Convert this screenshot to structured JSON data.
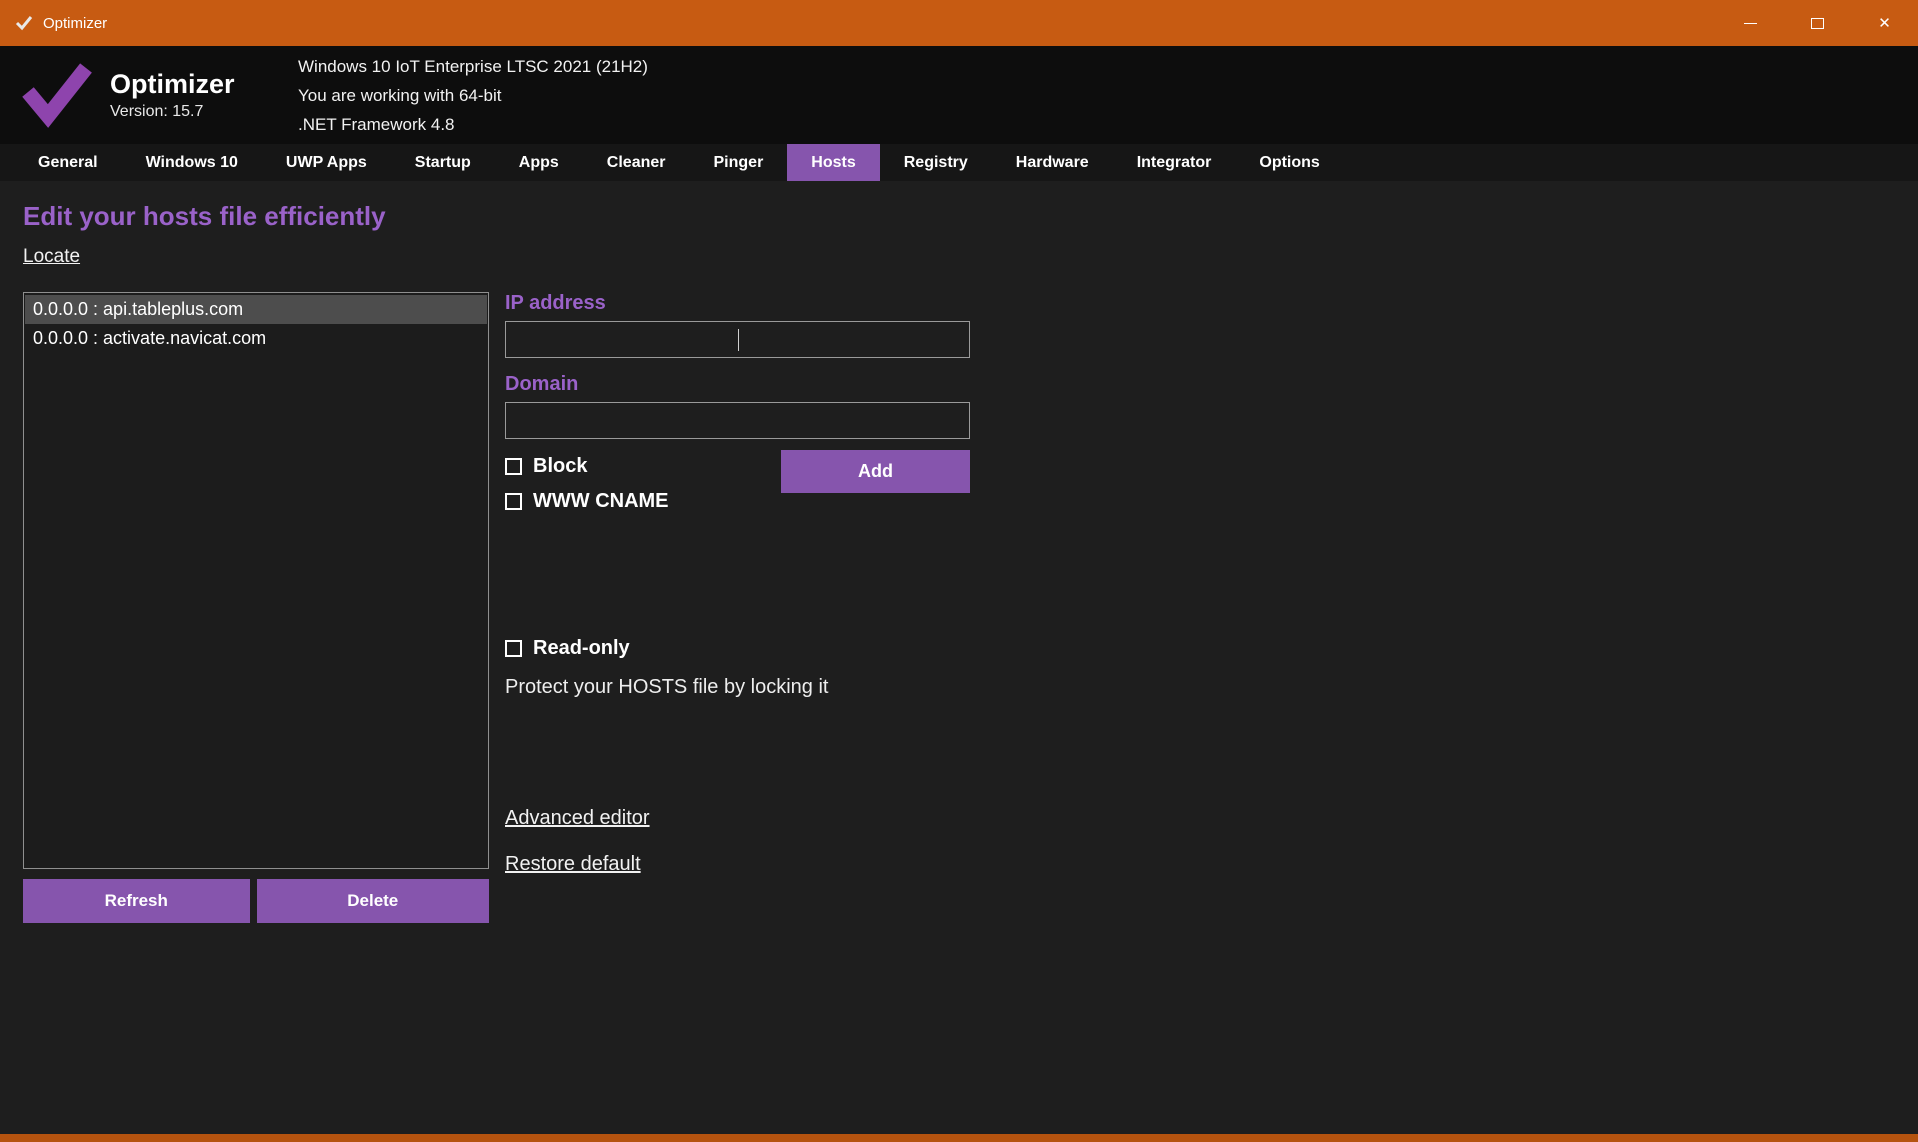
{
  "colors": {
    "titlebar_orange": "#c75b12",
    "accent_purple": "#8655ad",
    "heading_purple": "#9a62c9",
    "header_background": "#0d0d0d",
    "content_background": "#1e1e1e",
    "selected_item_gray": "#4d4d4d"
  },
  "titlebar": {
    "title": "Optimizer",
    "close_glyph": "✕"
  },
  "header": {
    "app_name": "Optimizer",
    "version": "Version: 15.7",
    "info_lines": [
      "Windows 10 IoT Enterprise LTSC 2021 (21H2)",
      "You are working with 64-bit",
      ".NET Framework 4.8"
    ]
  },
  "tabs": [
    {
      "label": "General",
      "active": false
    },
    {
      "label": "Windows 10",
      "active": false
    },
    {
      "label": "UWP Apps",
      "active": false
    },
    {
      "label": "Startup",
      "active": false
    },
    {
      "label": "Apps",
      "active": false
    },
    {
      "label": "Cleaner",
      "active": false
    },
    {
      "label": "Pinger",
      "active": false
    },
    {
      "label": "Hosts",
      "active": true
    },
    {
      "label": "Registry",
      "active": false
    },
    {
      "label": "Hardware",
      "active": false
    },
    {
      "label": "Integrator",
      "active": false
    },
    {
      "label": "Options",
      "active": false
    }
  ],
  "hosts_page": {
    "heading": "Edit your hosts file efficiently",
    "locate_link": "Locate",
    "entries": [
      {
        "text": "0.0.0.0 : api.tableplus.com",
        "selected": true
      },
      {
        "text": "0.0.0.0 : activate.navicat.com",
        "selected": false
      }
    ],
    "refresh_button": "Refresh",
    "delete_button": "Delete",
    "ip_label": "IP address",
    "ip_value": "",
    "domain_label": "Domain",
    "domain_value": "",
    "block_checkbox": {
      "label": "Block",
      "checked": false
    },
    "www_cname_checkbox": {
      "label": "WWW CNAME",
      "checked": false
    },
    "add_button": "Add",
    "readonly_checkbox": {
      "label": "Read-only",
      "checked": false
    },
    "readonly_hint": "Protect your HOSTS file by locking it",
    "advanced_editor_link": "Advanced editor",
    "restore_default_link": "Restore default"
  }
}
